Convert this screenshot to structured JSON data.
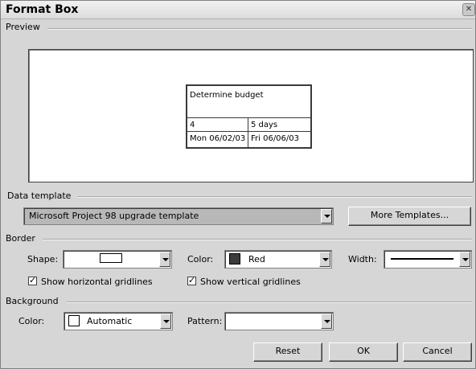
{
  "window": {
    "title": "Format Box",
    "close_glyph": "✕"
  },
  "preview": {
    "label": "Preview",
    "box": {
      "name": "Determine budget",
      "id": "4",
      "duration": "5 days",
      "start": "Mon 06/02/03",
      "finish": "Fri 06/06/03"
    }
  },
  "data_template": {
    "label": "Data template",
    "selected": "Microsoft Project 98 upgrade template",
    "more_button": "More Templates..."
  },
  "border": {
    "label": "Border",
    "shape_label": "Shape:",
    "color_label": "Color:",
    "color_value": "Red",
    "color_hex": "#3c3c3c",
    "width_label": "Width:",
    "horizontal_gridlines_label": "Show horizontal gridlines",
    "horizontal_gridlines_checked": true,
    "vertical_gridlines_label": "Show vertical gridlines",
    "vertical_gridlines_checked": true
  },
  "background": {
    "label": "Background",
    "color_label": "Color:",
    "color_value": "Automatic",
    "pattern_label": "Pattern:",
    "pattern_value": ""
  },
  "buttons": {
    "reset": "Reset",
    "ok": "OK",
    "cancel": "Cancel"
  }
}
